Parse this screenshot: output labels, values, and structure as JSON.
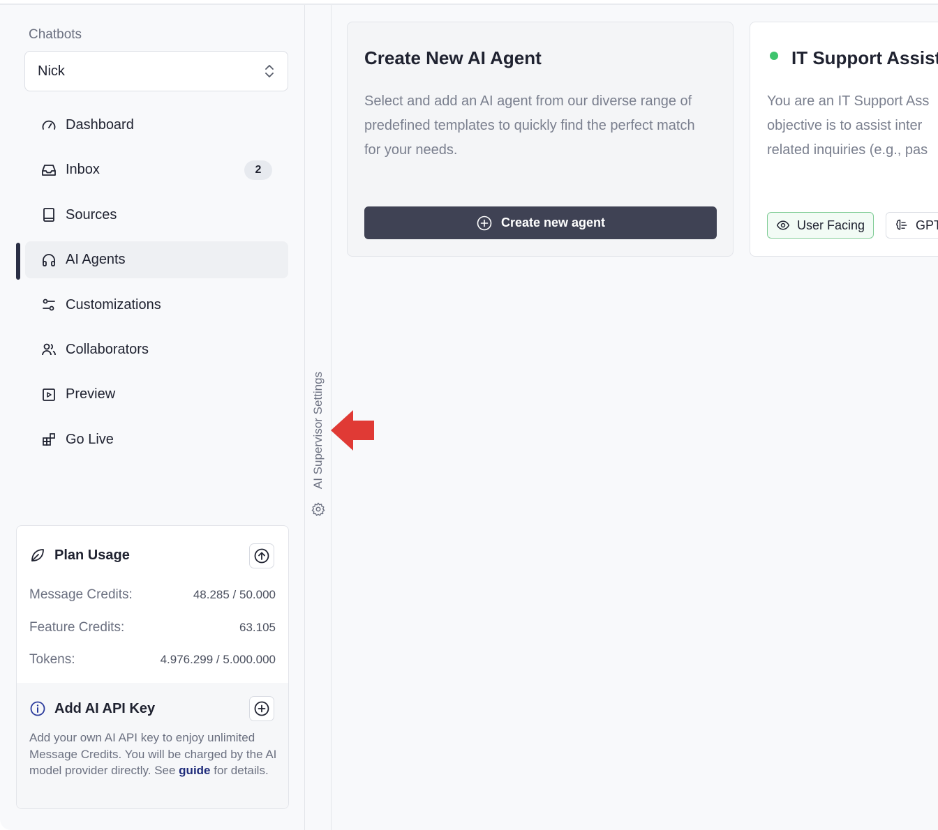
{
  "sidebar": {
    "title": "Chatbots",
    "selected_chatbot": "Nick",
    "items": [
      {
        "label": "Dashboard",
        "icon": "gauge-icon"
      },
      {
        "label": "Inbox",
        "icon": "inbox-icon",
        "badge": "2"
      },
      {
        "label": "Sources",
        "icon": "book-icon"
      },
      {
        "label": "AI Agents",
        "icon": "headphones-icon",
        "active": true
      },
      {
        "label": "Customizations",
        "icon": "sliders-icon"
      },
      {
        "label": "Collaborators",
        "icon": "users-icon"
      },
      {
        "label": "Preview",
        "icon": "play-square-icon"
      },
      {
        "label": "Go Live",
        "icon": "blocks-icon"
      }
    ]
  },
  "plan": {
    "title": "Plan Usage",
    "message_credits_label": "Message Credits:",
    "message_credits_value": "48.285 / 50.000",
    "feature_credits_label": "Feature Credits:",
    "feature_credits_value": "63.105",
    "tokens_label": "Tokens:",
    "tokens_value": "4.976.299 / 5.000.000"
  },
  "api_key": {
    "title": "Add AI API Key",
    "desc_before": "Add your own AI API key to enjoy unlimited Message Credits. You will be charged by the AI model provider directly. See ",
    "link": "guide",
    "desc_after": " for details."
  },
  "supervisor": {
    "label": "AI Supervisor Settings"
  },
  "cards": {
    "create": {
      "title": "Create New AI Agent",
      "description": "Select and add an AI agent from our diverse range of predefined templates to quickly find the perfect match for your needs.",
      "button": "Create new agent"
    },
    "agent": {
      "title": "IT Support Assist",
      "line1": "You are an IT Support Ass",
      "line2": "objective is to assist inter",
      "line3": "related inquiries (e.g., pas",
      "tag_user": "User Facing",
      "tag_model": "GPT"
    }
  },
  "colors": {
    "accent_dark": "#3f4254",
    "status_green": "#3ec46d",
    "arrow_red": "#e03a35",
    "link": "#1e2b7a"
  }
}
